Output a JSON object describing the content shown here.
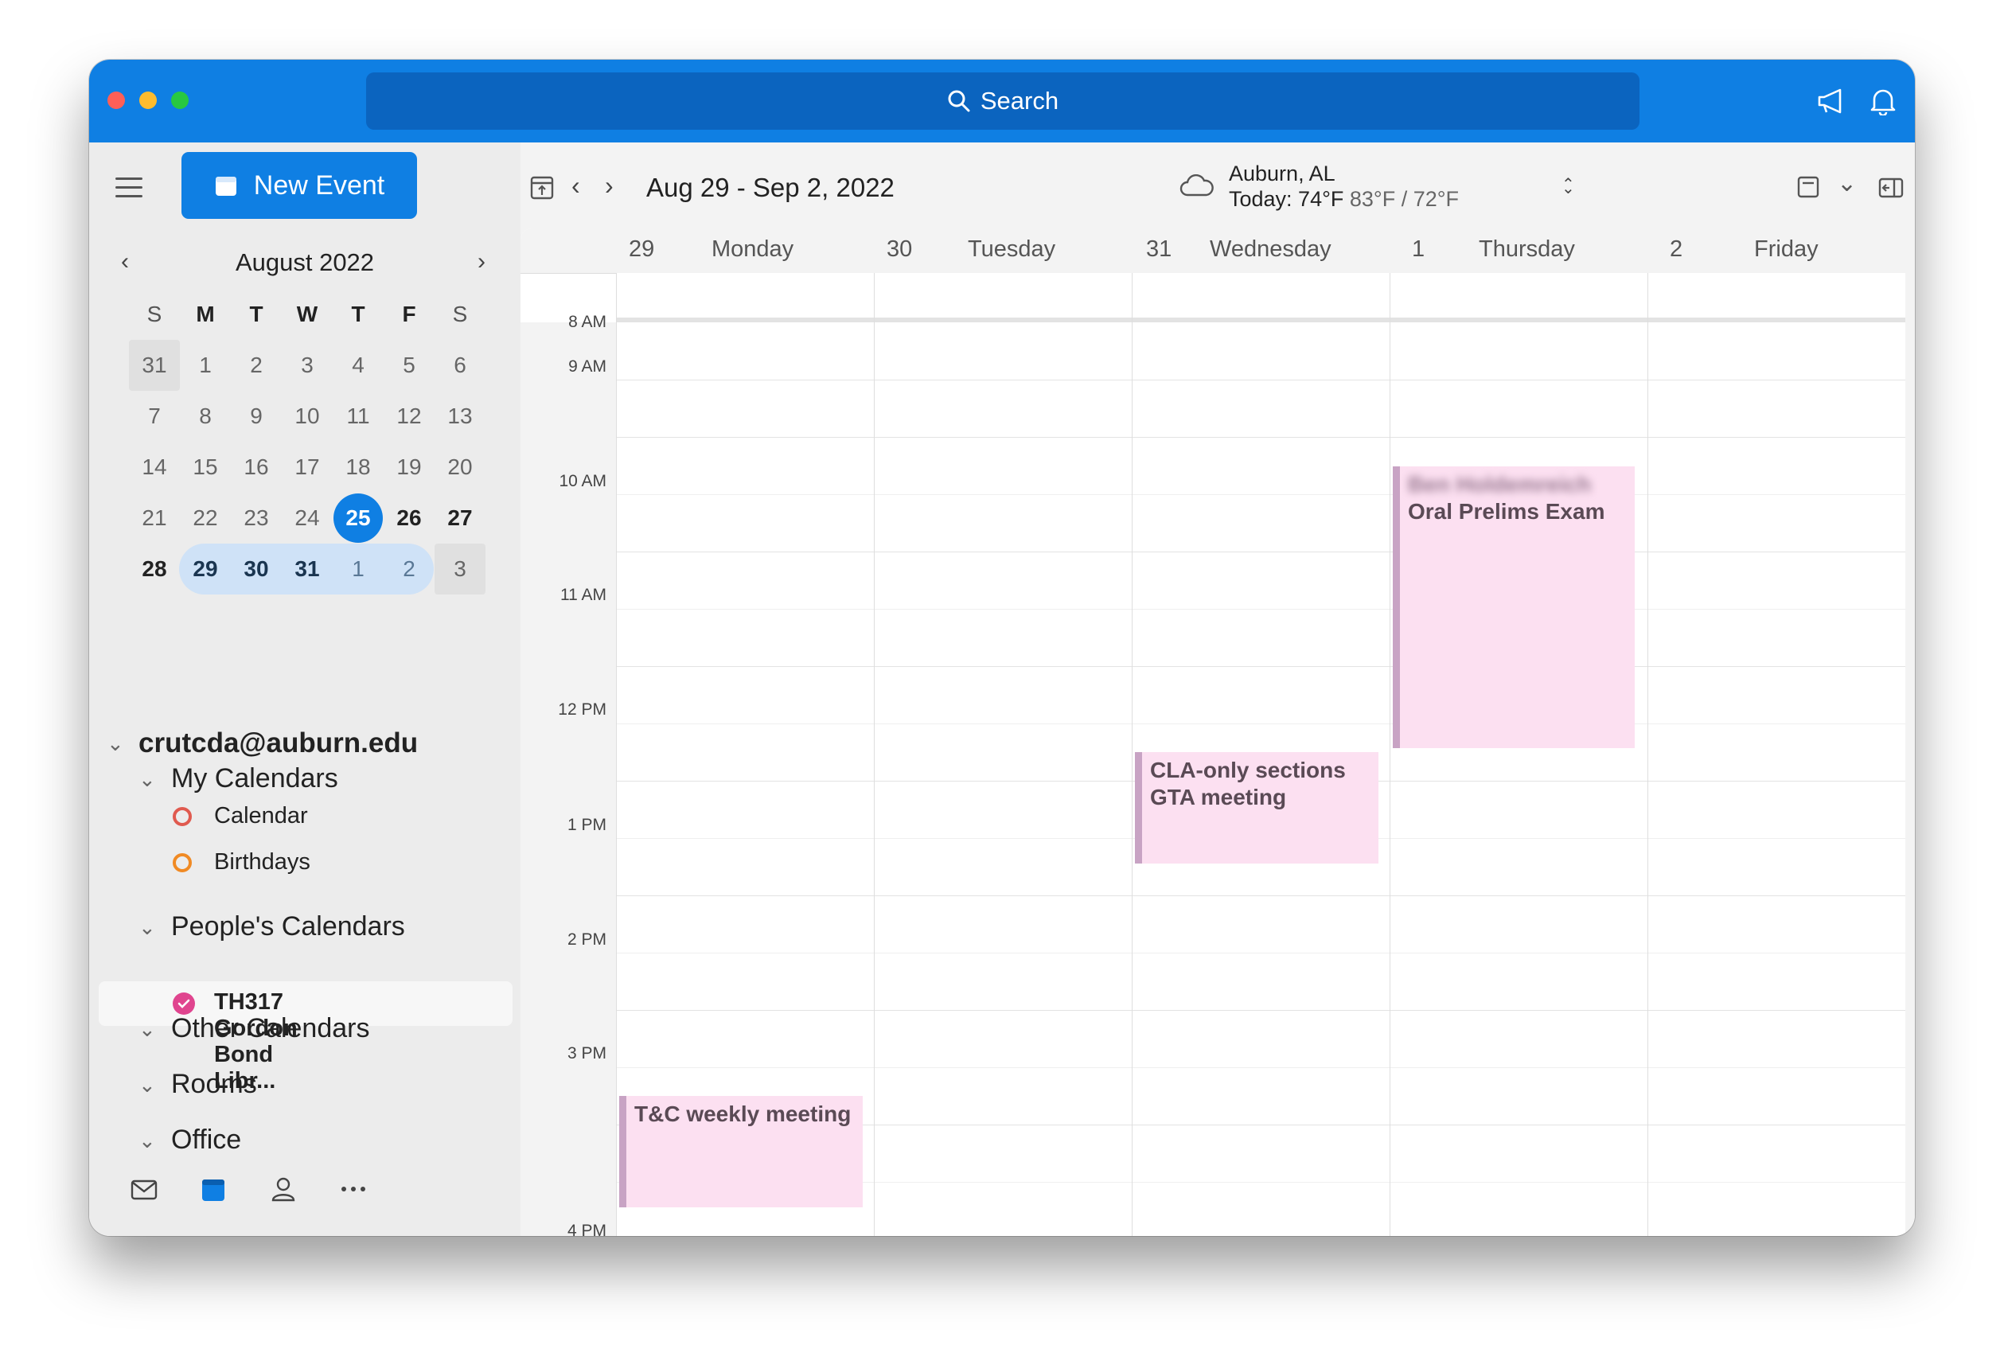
{
  "search": {
    "placeholder": "Search"
  },
  "sidebar": {
    "new_event_label": "New Event",
    "mini_cal": {
      "title": "August 2022",
      "weekdays": [
        "S",
        "M",
        "T",
        "W",
        "T",
        "F",
        "S"
      ],
      "weeks": [
        [
          "31",
          "1",
          "2",
          "3",
          "4",
          "5",
          "6"
        ],
        [
          "7",
          "8",
          "9",
          "10",
          "11",
          "12",
          "13"
        ],
        [
          "14",
          "15",
          "16",
          "17",
          "18",
          "19",
          "20"
        ],
        [
          "21",
          "22",
          "23",
          "24",
          "25",
          "26",
          "27"
        ],
        [
          "28",
          "29",
          "30",
          "31",
          "1",
          "2",
          "3"
        ]
      ],
      "today": "25"
    },
    "account": "crutcda@auburn.edu",
    "groups": {
      "my_calendars": "My Calendars",
      "calendar": "Calendar",
      "birthdays": "Birthdays",
      "peoples_calendars": "People's Calendars",
      "th317": "TH317 Gordon Bond Libr...",
      "other_calendars": "Other Calendars",
      "rooms": "Rooms",
      "office": "Office"
    },
    "colors": {
      "calendar": "#e05a4f",
      "birthdays": "#f08a24",
      "th317": "#e0458f"
    }
  },
  "toolbar": {
    "date_range": "Aug 29 - Sep 2, 2022",
    "weather_location": "Auburn, AL",
    "weather_today": "Today: 74°F",
    "weather_range": "83°F / 72°F"
  },
  "week": {
    "days": [
      {
        "num": "29",
        "name": "Monday"
      },
      {
        "num": "30",
        "name": "Tuesday"
      },
      {
        "num": "31",
        "name": "Wednesday"
      },
      {
        "num": "1",
        "name": "Thursday"
      },
      {
        "num": "2",
        "name": "Friday"
      }
    ],
    "times": [
      "8 AM",
      "9 AM",
      "10 AM",
      "11 AM",
      "12 PM",
      "1 PM",
      "2 PM",
      "3 PM",
      "4 PM"
    ]
  },
  "events": {
    "oral_prelims_blurred": "Ben Holdemreich",
    "oral_prelims": "Oral Prelims Exam",
    "cla_line1": "CLA-only sections",
    "cla_line2": "GTA meeting",
    "tc_weekly": "T&C weekly meeting"
  },
  "theme": {
    "accent": "#0f7fe3",
    "event_bg": "#fce0f1",
    "event_bar": "#c8a3c4"
  }
}
